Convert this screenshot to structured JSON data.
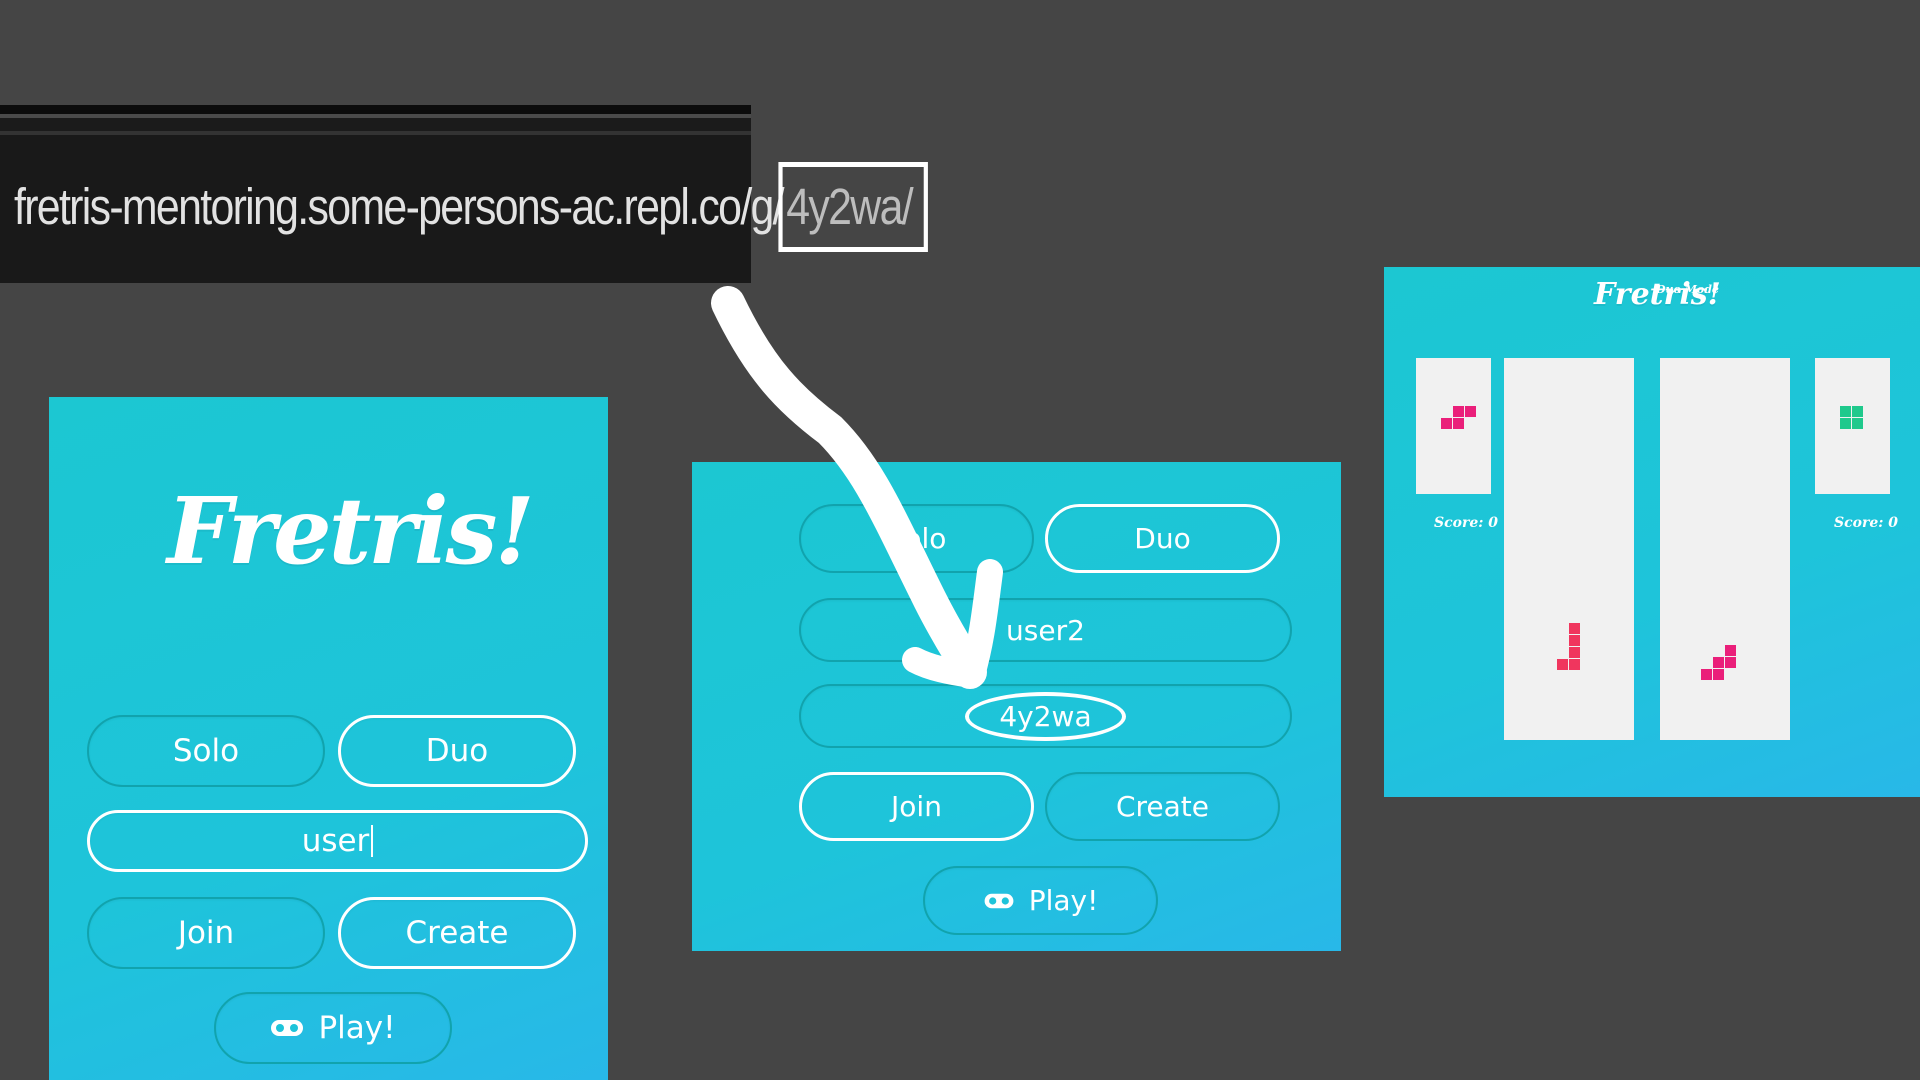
{
  "url_bar": {
    "url_prefix": "fretris-mentoring.some-persons-ac.repl.co/g/",
    "url_code": "4y2wa/"
  },
  "panel_start": {
    "logo": "Fretris!",
    "mode_buttons": [
      "Solo",
      "Duo"
    ],
    "username_value": "user",
    "action_buttons": [
      "Join",
      "Create"
    ],
    "play_label": "Play!"
  },
  "panel_join": {
    "mode_buttons": [
      "Solo",
      "Duo"
    ],
    "username_value": "user2",
    "room_code_value": "4y2wa",
    "action_buttons": [
      "Join",
      "Create"
    ],
    "play_label": "Play!"
  },
  "panel_game": {
    "logo": "Fretris!",
    "mode_label": "Duo Mode",
    "left_score": "Score: 0",
    "right_score": "Score: 0"
  },
  "colors": {
    "panel": "#1ec4da",
    "pink_piece": "#ea1f7a",
    "red_piece": "#f0365e",
    "green_piece": "#1fc98c",
    "arrow": "#ffffff"
  }
}
